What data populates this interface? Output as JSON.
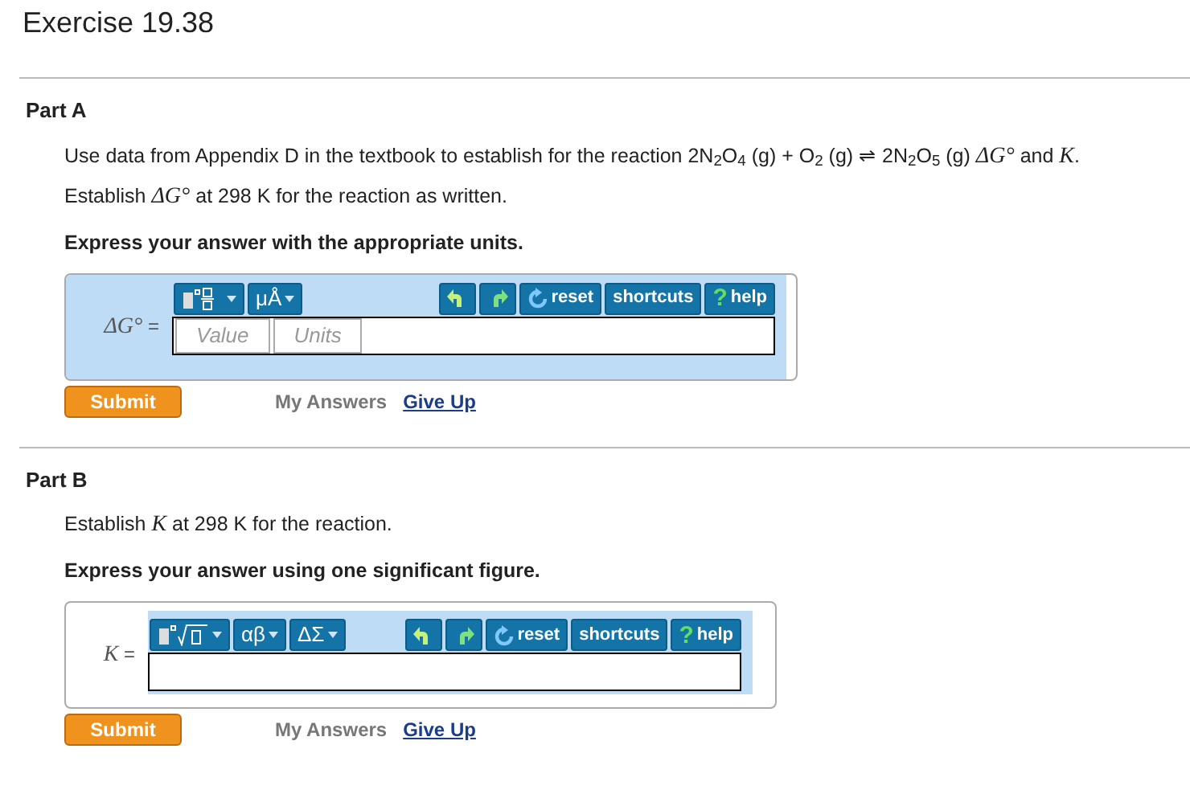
{
  "title": "Exercise 19.38",
  "parts": [
    {
      "heading": "Part A",
      "paragraphs": [
        "Use data from Appendix D in the textbook to establish for the reaction 2N$_{2}$O$_{4}$ (g) + O$_{2}$ (g) ⇌ 2N$_{2}$O$_{5}$ (g) *ΔG°* and *K*.",
        "Establish *ΔG°* at 298 K for the reaction as written."
      ],
      "instruction": "Express your answer with the appropriate units.",
      "answer": {
        "kind": "value_units",
        "label": "*ΔG°* =",
        "value_placeholder": "Value",
        "units_placeholder": "Units",
        "templates": [
          {
            "kind": "icon"
          },
          {
            "kind": "text",
            "label": "μÅ"
          }
        ],
        "tools": [
          {
            "kind": "undo"
          },
          {
            "kind": "redo"
          },
          {
            "kind": "reset",
            "label": "reset"
          },
          {
            "kind": "text",
            "label": "shortcuts"
          },
          {
            "kind": "help",
            "glyph": "?",
            "label": "help"
          }
        ]
      },
      "submit": "Submit",
      "my_answers": "My Answers",
      "give_up": "Give Up"
    },
    {
      "heading": "Part B",
      "paragraphs": [
        "Establish *K* at 298 K for the reaction."
      ],
      "instruction": "Express your answer using one significant figure.",
      "answer": {
        "kind": "plain",
        "label": "*K* =",
        "templates": [
          {
            "kind": "icon"
          },
          {
            "kind": "text",
            "label": "αβ"
          },
          {
            "kind": "text",
            "label": "ΔΣ"
          }
        ],
        "tools": [
          {
            "kind": "undo"
          },
          {
            "kind": "redo"
          },
          {
            "kind": "reset",
            "label": "reset"
          },
          {
            "kind": "text",
            "label": "shortcuts"
          },
          {
            "kind": "help",
            "glyph": "?",
            "label": "help"
          }
        ]
      },
      "submit": "Submit",
      "my_answers": "My Answers",
      "give_up": "Give Up"
    }
  ]
}
